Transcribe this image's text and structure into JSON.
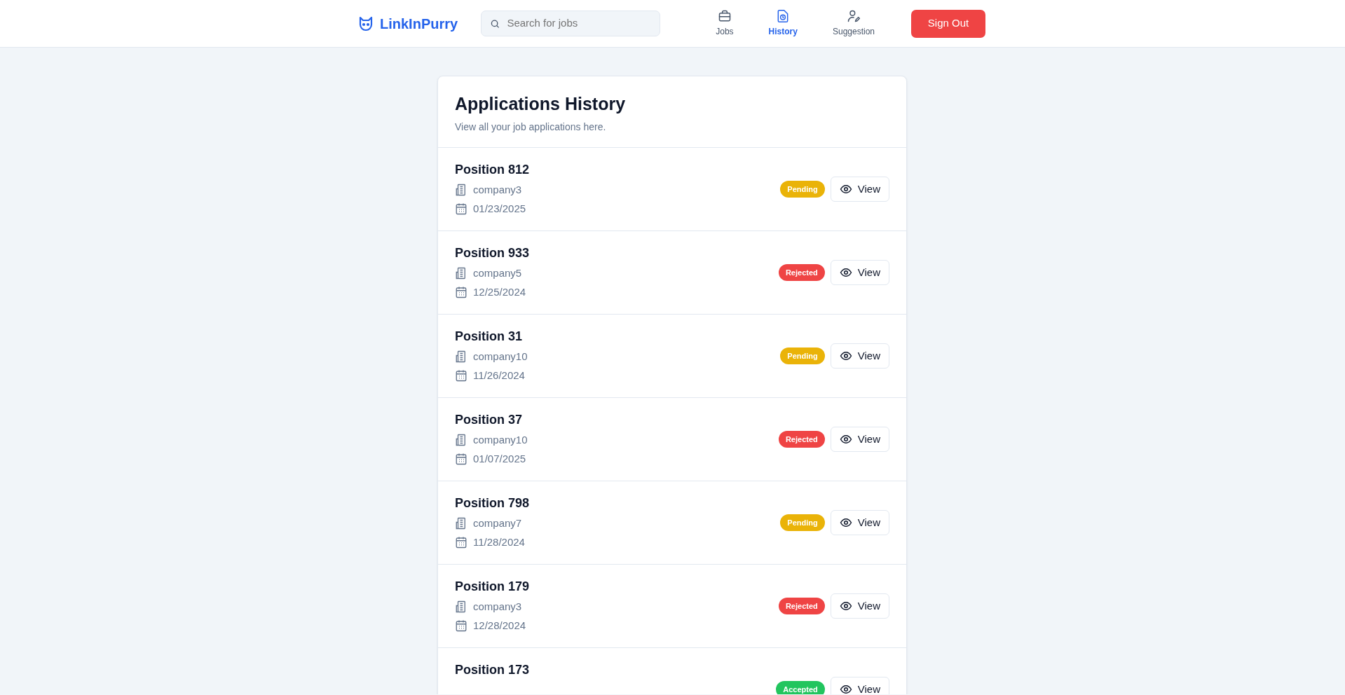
{
  "brand": {
    "name": "LinkInPurry"
  },
  "search": {
    "placeholder": "Search for jobs"
  },
  "nav": [
    {
      "label": "Jobs",
      "selected": false
    },
    {
      "label": "History",
      "selected": true
    },
    {
      "label": "Suggestion",
      "selected": false
    }
  ],
  "sign_out": "Sign Out",
  "page": {
    "title": "Applications History",
    "subtitle": "View all your job applications here."
  },
  "applications": [
    {
      "position": "Position 812",
      "company": "company3",
      "date": "01/23/2025",
      "status": "Pending",
      "color": "#eab308",
      "action": "View"
    },
    {
      "position": "Position 933",
      "company": "company5",
      "date": "12/25/2024",
      "status": "Rejected",
      "color": "#ef4444",
      "action": "View"
    },
    {
      "position": "Position 31",
      "company": "company10",
      "date": "11/26/2024",
      "status": "Pending",
      "color": "#eab308",
      "action": "View"
    },
    {
      "position": "Position 37",
      "company": "company10",
      "date": "01/07/2025",
      "status": "Rejected",
      "color": "#ef4444",
      "action": "View"
    },
    {
      "position": "Position 798",
      "company": "company7",
      "date": "11/28/2024",
      "status": "Pending",
      "color": "#eab308",
      "action": "View"
    },
    {
      "position": "Position 179",
      "company": "company3",
      "date": "12/28/2024",
      "status": "Rejected",
      "color": "#ef4444",
      "action": "View"
    },
    {
      "position": "Position 173",
      "status": "Accepted",
      "color": "#22c55e",
      "action": "View"
    }
  ]
}
